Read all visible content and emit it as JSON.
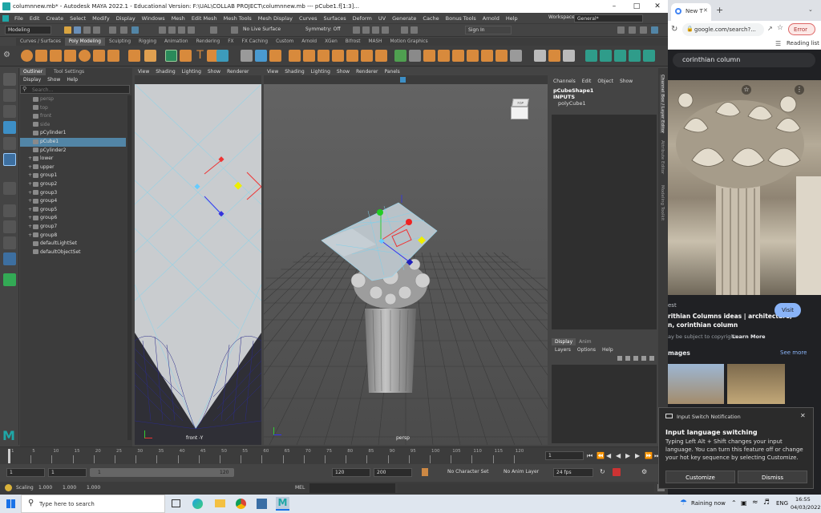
{
  "maya": {
    "title": "columnnew.mb* - Autodesk MAYA 2022.1 - Educational Version: F:\\UAL\\COLLAB PROJECT\\columnnew.mb   ---   pCube1.f[1:3]...",
    "menus": [
      "File",
      "Edit",
      "Create",
      "Select",
      "Modify",
      "Display",
      "Windows",
      "Mesh",
      "Edit Mesh",
      "Mesh Tools",
      "Mesh Display",
      "Curves",
      "Surfaces",
      "Deform",
      "UV",
      "Generate",
      "Cache",
      "Bonus Tools",
      "Arnold",
      "Help"
    ],
    "workspace_label": "Workspace:",
    "workspace_value": "General*",
    "mode_value": "Modeling",
    "live_surface": "No Live Surface",
    "symmetry": "Symmetry: Off",
    "sign_in": "Sign In",
    "shelf_tabs": [
      "Curves / Surfaces",
      "Poly Modeling",
      "Sculpting",
      "Rigging",
      "Animation",
      "Rendering",
      "FX",
      "FX Caching",
      "Custom",
      "Arnold",
      "XGen",
      "Bifrost",
      "MASH",
      "Motion Graphics"
    ],
    "outliner": {
      "tabs": [
        "Outliner",
        "Tool Settings"
      ],
      "menu": [
        "Display",
        "Show",
        "Help"
      ],
      "search_placeholder": "Search...",
      "items": [
        {
          "label": "persp",
          "dim": true,
          "plus": false
        },
        {
          "label": "top",
          "dim": true,
          "plus": false
        },
        {
          "label": "front",
          "dim": true,
          "plus": false
        },
        {
          "label": "side",
          "dim": true,
          "plus": false
        },
        {
          "label": "pCylinder1",
          "dim": false,
          "plus": false
        },
        {
          "label": "pCube1",
          "dim": false,
          "plus": false,
          "selected": true
        },
        {
          "label": "pCylinder2",
          "dim": false,
          "plus": false
        },
        {
          "label": "lower",
          "dim": false,
          "plus": true
        },
        {
          "label": "upper",
          "dim": false,
          "plus": true
        },
        {
          "label": "group1",
          "dim": false,
          "plus": true
        },
        {
          "label": "group2",
          "dim": false,
          "plus": true
        },
        {
          "label": "group3",
          "dim": false,
          "plus": true
        },
        {
          "label": "group4",
          "dim": false,
          "plus": true
        },
        {
          "label": "group5",
          "dim": false,
          "plus": true
        },
        {
          "label": "group6",
          "dim": false,
          "plus": true
        },
        {
          "label": "group7",
          "dim": false,
          "plus": true
        },
        {
          "label": "group8",
          "dim": false,
          "plus": true
        },
        {
          "label": "defaultLightSet",
          "dim": false,
          "plus": false
        },
        {
          "label": "defaultObjectSet",
          "dim": false,
          "plus": false
        }
      ]
    },
    "viewport_menu_front": [
      "View",
      "Shading",
      "Lighting",
      "Show",
      "Renderer"
    ],
    "viewport_menu_persp": [
      "View",
      "Shading",
      "Lighting",
      "Show",
      "Renderer",
      "Panels"
    ],
    "front_label": "front -Y",
    "persp_label": "persp",
    "viewcube_label": "TOP",
    "channel": {
      "menu": [
        "Channels",
        "Edit",
        "Object",
        "Show"
      ],
      "shape": "pCubeShape1",
      "inputs": "INPUTS",
      "input_item": "polyCube1",
      "layer_tabs": [
        "Display",
        "Anim"
      ],
      "layer_menu": [
        "Layers",
        "Options",
        "Help"
      ]
    },
    "side_tabs": [
      "Channel Box / Layer Editor",
      "Attribute Editor",
      "Modeling Toolkit"
    ],
    "timeline_ticks": [
      "1",
      "5",
      "10",
      "15",
      "20",
      "25",
      "30",
      "35",
      "40",
      "45",
      "50",
      "55",
      "60",
      "65",
      "70",
      "75",
      "80",
      "85",
      "90",
      "95",
      "100",
      "105",
      "110",
      "115",
      "120"
    ],
    "current_frame": "1",
    "range": {
      "start": "1",
      "inner_start": "1",
      "bar_start": "1",
      "bar_end": "120",
      "inner_end": "120",
      "end": "200"
    },
    "character_set": "No Character Set",
    "anim_layer": "No Anim Layer",
    "fps": "24 fps",
    "cmd": {
      "scaling_label": "Scaling",
      "v1": "1.000",
      "v2": "1.000",
      "v3": "1.000",
      "mel": "MEL"
    }
  },
  "browser": {
    "tab_label": "New T",
    "url": "google.com/search?...",
    "error_label": "Error",
    "reading_list": "Reading list",
    "search_query": "corinthian column",
    "source_prefix": "est",
    "result_title": "rithian Columns ideas | architecture,",
    "result_title2": "n, corinthian column",
    "visit": "Visit",
    "copyright": "ay be subject to copyright.",
    "learn_more": "Learn More",
    "images_heading": "mages",
    "see_more": "See more"
  },
  "notification": {
    "header": "Input Switch Notification",
    "title": "Input language switching",
    "body": "Typing Left Alt + Shift changes your input language. You can turn this feature off or change your hot key sequence by selecting Customize.",
    "customize": "Customize",
    "dismiss": "Dismiss"
  },
  "taskbar": {
    "search_placeholder": "Type here to search",
    "weather": "Raining now",
    "lang": "ENG",
    "time": "16:55",
    "date": "04/03/2022"
  },
  "colors": {
    "accent_blue": "#5285a6",
    "maya_teal": "#1fa6a6"
  }
}
